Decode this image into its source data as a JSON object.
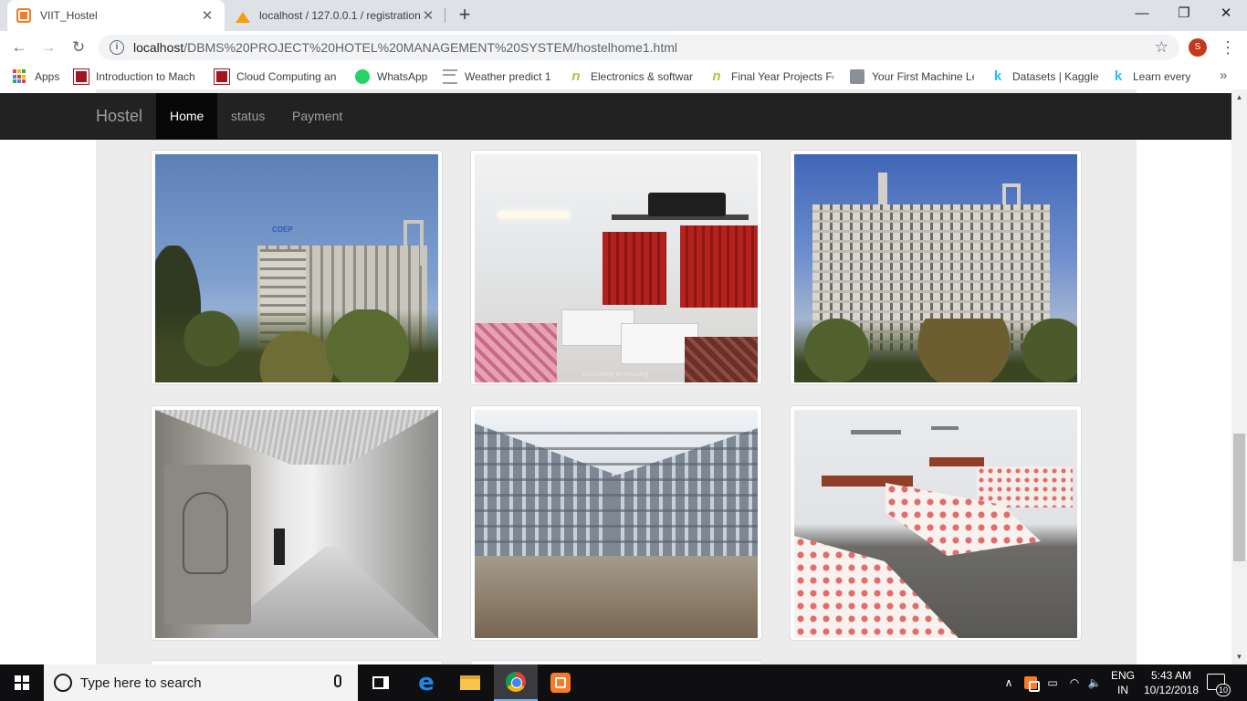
{
  "browser": {
    "tabs": [
      {
        "title": "VIIT_Hostel",
        "icon": "xampp-icon",
        "active": true
      },
      {
        "title": "localhost / 127.0.0.1 / registration",
        "icon": "phpmyadmin-icon",
        "active": false
      }
    ],
    "new_tab": "+",
    "window_controls": {
      "minimize": "—",
      "restore": "❐",
      "close": "✕"
    },
    "url": {
      "host": "localhost",
      "path": "/DBMS%20PROJECT%20HOTEL%20MANAGEMENT%20SYSTEM/hostelhome1.html"
    },
    "profile_initial": "S",
    "bookmarks": [
      {
        "label": "Apps",
        "icon": "apps-grid-icon"
      },
      {
        "label": "Introduction to Mach",
        "icon": "coursera-icon"
      },
      {
        "label": "Cloud Computing an",
        "icon": "coursera-icon"
      },
      {
        "label": "WhatsApp",
        "icon": "whatsapp-icon"
      },
      {
        "label": "Weather predict 1",
        "icon": "weather-icon"
      },
      {
        "label": "Electronics & softwar",
        "icon": "n-logo-icon"
      },
      {
        "label": "Final Year Projects Fo",
        "icon": "n-logo-icon"
      },
      {
        "label": "Your First Machine Le",
        "icon": "person-icon"
      },
      {
        "label": "Datasets | Kaggle",
        "icon": "kaggle-icon"
      },
      {
        "label": "Learn every",
        "icon": "kaggle-icon"
      }
    ],
    "bookmarks_more": "»"
  },
  "site": {
    "brand": "Hostel",
    "nav": [
      {
        "label": "Home",
        "active": true
      },
      {
        "label": "status",
        "active": false
      },
      {
        "label": "Payment",
        "active": false
      }
    ],
    "gallery_watermark": "Exclusively on Housing",
    "building_sign": "COEP"
  },
  "taskbar": {
    "search_placeholder": "Type here to search",
    "language": "ENG",
    "region": "IN",
    "time": "5:43 AM",
    "date": "10/12/2018",
    "notifications": "10"
  },
  "colors": {
    "navbar_bg": "#222222",
    "navbar_active_bg": "#080808",
    "page_bg": "#ececec",
    "xampp_orange": "#fb7a24"
  }
}
